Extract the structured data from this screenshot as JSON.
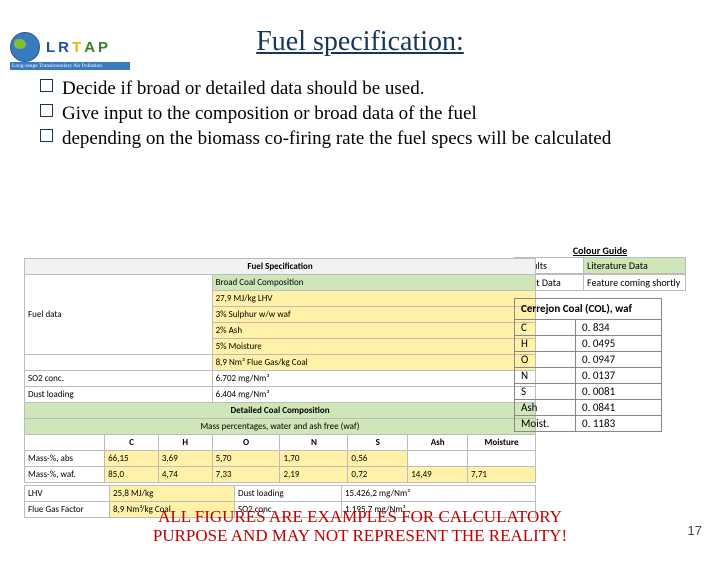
{
  "logo": {
    "letters": "LRTAP",
    "tagline": "Long-range Transboundary Air Pollution"
  },
  "title": "Fuel  specification:",
  "bullets": [
    "Decide if broad or detailed data should be used.",
    "Give input to the composition or broad data of the fuel",
    "depending on the biomass co-firing rate the fuel specs will be calculated"
  ],
  "colour_guide": {
    "title": "Colour Guide",
    "rows": [
      {
        "l": "Results",
        "r": "Literature Data",
        "cls": "green"
      },
      {
        "l": "Input Data",
        "r": "Feature coming shortly",
        "cls": "yellow"
      }
    ]
  },
  "sheet": {
    "fuel_spec": "Fuel Specification",
    "broad_head": "Broad Coal Composition",
    "fuel_data": "Fuel data",
    "so2_label": "SO2 conc.",
    "dust_label": "Dust loading",
    "broad": [
      "27,9 MJ/kg LHV",
      "3% Sulphur w/w waf",
      "2% Ash",
      "5% Moisture",
      "8,9 Nm³ Flue Gas/kg Coal",
      "6.702 mg/Nm³",
      "6.404 mg/Nm³"
    ],
    "det_head": "Detailed Coal Composition",
    "det_sub": "Mass percentages, water and ash free (waf)",
    "cols": [
      "",
      "C",
      "H",
      "O",
      "N",
      "S",
      "Ash",
      "Moisture"
    ],
    "row_abs": [
      "Mass-%, abs",
      "66,15",
      "3,69",
      "5,70",
      "1,70",
      "0,56",
      "",
      ""
    ],
    "row_waf": [
      "Mass-%, waf.",
      "85,0",
      "4,74",
      "7,33",
      "2,19",
      "0,72",
      "14,49",
      "7,71"
    ],
    "lhv": [
      "LHV",
      "25,8 MJ/kg",
      "Dust loading",
      "15.426,2 mg/Nm³"
    ],
    "fgf": [
      "Flue Gas Factor",
      "8,9 Nm³/kg Coal",
      "SO2 conc.",
      "1.195,7 mg/Nm³"
    ]
  },
  "col": {
    "title": "Cerrejon Coal (COL), waf",
    "rows": [
      [
        "C",
        "0. 834"
      ],
      [
        "H",
        "0. 0495"
      ],
      [
        "O",
        "0. 0947"
      ],
      [
        "N",
        "0. 0137"
      ],
      [
        "S",
        "0. 0081"
      ],
      [
        "Ash",
        "0. 0841"
      ],
      [
        "Moist.",
        "0. 1183"
      ]
    ]
  },
  "footer": [
    "ALL FIGURES ARE EXAMPLES FOR CALCULATORY",
    "PURPOSE AND MAY NOT REPRESENT THE REALITY!"
  ],
  "pagenum": "17"
}
